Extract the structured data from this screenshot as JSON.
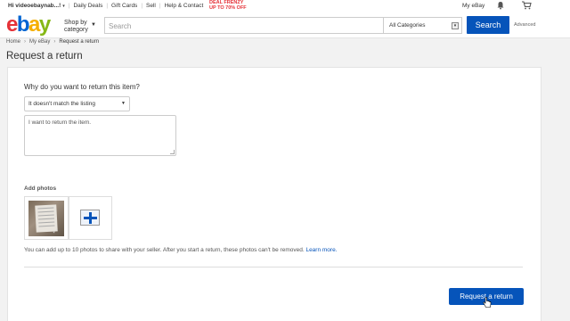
{
  "topbar": {
    "greeting": "Hi videoebaynab...!",
    "links": [
      "Daily Deals",
      "Gift Cards",
      "Sell",
      "Help & Contact"
    ],
    "promo_line1": "DEAL FRENZY",
    "promo_line2": "UP TO 70% OFF",
    "my_ebay": "My eBay",
    "icons": [
      "bell-icon",
      "cart-icon"
    ]
  },
  "header": {
    "logo_letters": [
      "e",
      "b",
      "a",
      "y"
    ],
    "logo_colors": [
      "#e53238",
      "#0064d2",
      "#f5af02",
      "#86b817"
    ],
    "shop_by_line1": "Shop by",
    "shop_by_line2": "category",
    "search_placeholder": "Search",
    "category_selected": "All Categories",
    "search_button": "Search",
    "advanced_link": "Advanced"
  },
  "breadcrumb": [
    "Home",
    "My eBay",
    "Request a return"
  ],
  "page_title": "Request a return",
  "form": {
    "question": "Why do you want to return this item?",
    "reason_selected": "It doesn't match the listing",
    "comment_text": "I want to return the item.",
    "add_photos_label": "Add photos",
    "info_text": "You can add up to 10 photos to share with your seller. After you start a return, these photos can't be removed.",
    "learn_more": "Learn more.",
    "submit_label": "Request a return"
  },
  "colors": {
    "primary_button": "#0654ba",
    "promo": "#e53238"
  }
}
